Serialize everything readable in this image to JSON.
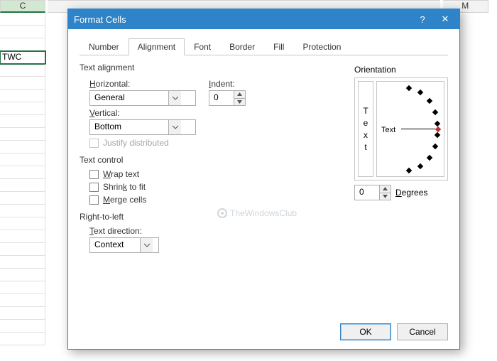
{
  "grid": {
    "columns": [
      "C",
      "",
      "",
      "",
      "",
      "",
      "",
      "",
      "M"
    ],
    "active_cell_value": "TWC"
  },
  "dialog": {
    "title": "Format Cells",
    "help": "?",
    "close": "✕",
    "tabs": [
      "Number",
      "Alignment",
      "Font",
      "Border",
      "Fill",
      "Protection"
    ],
    "active_tab": 1,
    "text_alignment": {
      "label": "Text alignment",
      "horizontal_label": "Horizontal:",
      "horizontal_value": "General",
      "vertical_label": "Vertical:",
      "vertical_value": "Bottom",
      "indent_label": "Indent:",
      "indent_value": "0",
      "justify_label": "Justify distributed"
    },
    "text_control": {
      "label": "Text control",
      "wrap": "Wrap text",
      "shrink": "Shrink to fit",
      "merge": "Merge cells"
    },
    "rtl": {
      "label": "Right-to-left",
      "direction_label": "Text direction:",
      "direction_value": "Context"
    },
    "orientation": {
      "label": "Orientation",
      "vtext": "Text",
      "htext": "Text",
      "degrees_value": "0",
      "degrees_label": "Degrees"
    },
    "buttons": {
      "ok": "OK",
      "cancel": "Cancel"
    }
  },
  "watermark": "TheWindowsClub"
}
